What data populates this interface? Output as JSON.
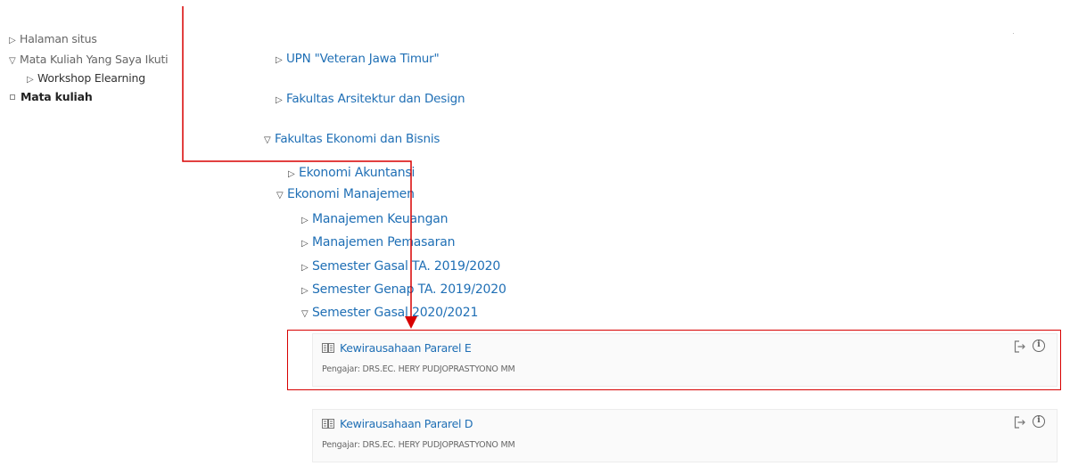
{
  "sidebar": {
    "items": [
      {
        "label": "Halaman situs",
        "state": "collapsed"
      },
      {
        "label": "Mata Kuliah Yang Saya Ikuti",
        "state": "expanded"
      },
      {
        "label": "Workshop Elearning",
        "state": "collapsed"
      },
      {
        "label": "Mata kuliah",
        "state": "current"
      }
    ]
  },
  "categories": {
    "upn": "UPN \"Veteran Jawa Timur\"",
    "arsitektur": "Fakultas Arsitektur dan Design",
    "ekonomi_bisnis": "Fakultas Ekonomi dan Bisnis",
    "ekonomi_akuntansi": "Ekonomi Akuntansi",
    "ekonomi_manajemen": "Ekonomi Manajemen",
    "manajemen_keuangan": "Manajemen Keuangan",
    "manajemen_pemasaran": "Manajemen Pemasaran",
    "sem_gasal_2019": "Semester Gasal TA. 2019/2020",
    "sem_genap_2019": "Semester Genap TA. 2019/2020",
    "sem_gasal_2020": "Semester Gasal 2020/2021"
  },
  "courses": [
    {
      "title": "Kewirausahaan Pararel E",
      "teacher": "Pengajar: DRS.EC. HERY PUDJOPRASTYONO MM"
    },
    {
      "title": "Kewirausahaan Pararel D",
      "teacher": "Pengajar: DRS.EC. HERY PUDJOPRASTYONO MM"
    }
  ],
  "icons": {
    "collapsed": "right-triangle-icon",
    "expanded": "down-triangle-icon",
    "course": "book-icon",
    "enrol": "enrol-icon",
    "info": "info-icon"
  },
  "colors": {
    "link": "#1f6fb5",
    "annotation": "#d80000"
  }
}
